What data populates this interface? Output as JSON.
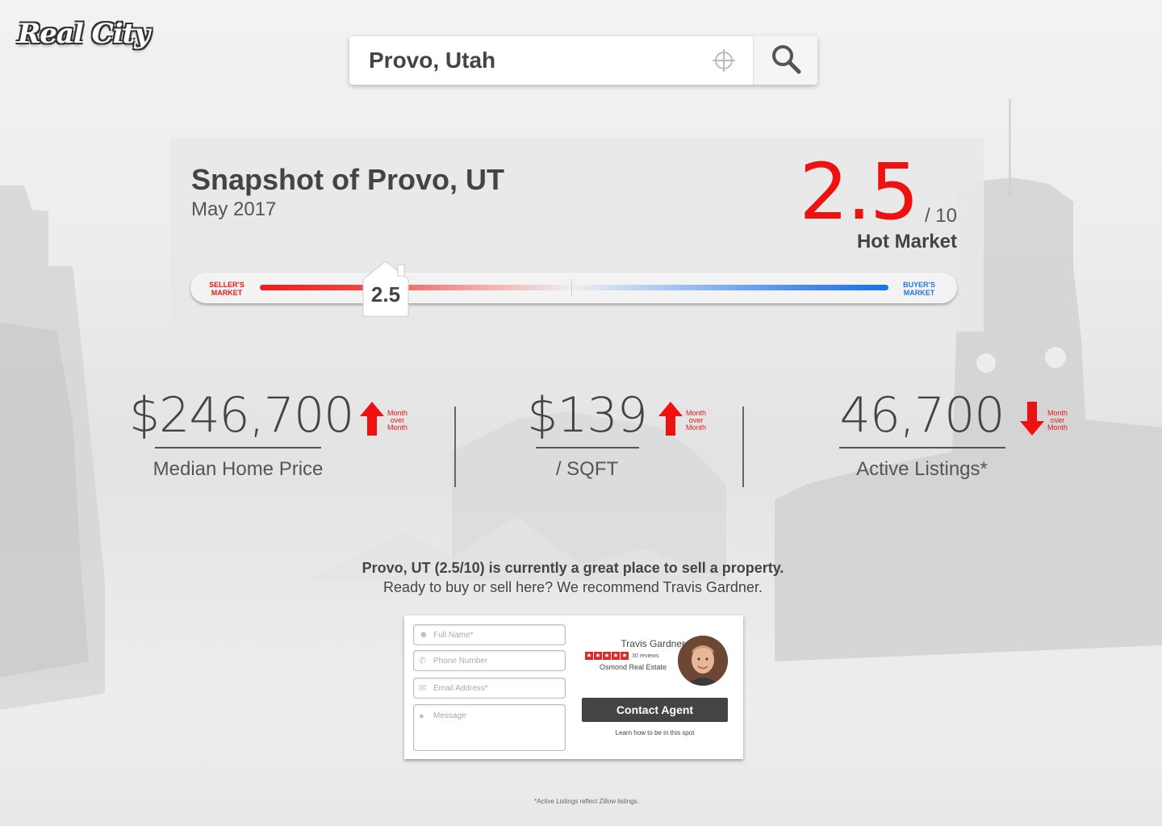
{
  "brand": {
    "logo_text": "Real City"
  },
  "search": {
    "value": "Provo, Utah",
    "locate_icon": "crosshair-icon",
    "search_icon": "magnifier-icon"
  },
  "snapshot": {
    "title": "Snapshot of Provo, UT",
    "date": "May 2017",
    "score": "2.5",
    "score_out_of": "/ 10",
    "market_label": "Hot Market",
    "meter": {
      "left_label_line1": "SELLER'S",
      "left_label_line2": "MARKET",
      "right_label_line1": "BUYER'S",
      "right_label_line2": "MARKET",
      "pin_value": "2.5",
      "level_fraction": 0.25,
      "seller_color": "#f21a1a",
      "buyer_color": "#1a6ff0"
    }
  },
  "stats": [
    {
      "value": "$246,700",
      "label": "Median Home Price",
      "trend": "up",
      "trend_l1": "Month",
      "trend_l2": "over",
      "trend_l3": "Month"
    },
    {
      "value": "$139",
      "label": "/ SQFT",
      "trend": "up",
      "trend_l1": "Month",
      "trend_l2": "over",
      "trend_l3": "Month"
    },
    {
      "value": "46,700",
      "label": "Active Listings*",
      "trend": "down",
      "trend_l1": "Month",
      "trend_l2": "over",
      "trend_l3": "Month"
    }
  ],
  "message": {
    "line1": "Provo, UT (2.5/10) is currently a great place to sell a property.",
    "line2": "Ready to buy or sell here? We recommend Travis Gardner."
  },
  "contact_form": {
    "name_placeholder": "Full Name*",
    "phone_placeholder": "Phone Number",
    "email_placeholder": "Email Address*",
    "message_placeholder": "Message",
    "agent_name": "Travis Gardner",
    "rating": 5,
    "reviews": "30 reviews",
    "agency": "Osmond Real Estate",
    "button_label": "Contact Agent",
    "learn_link": "Learn how to be in this spot"
  },
  "footnote": "*Active Listings reflect Zillow listings.",
  "colors": {
    "accent_red": "#ee1111",
    "accent_blue": "#2276e8",
    "dark_button": "#444444"
  }
}
